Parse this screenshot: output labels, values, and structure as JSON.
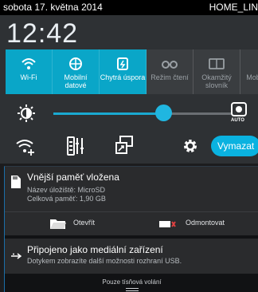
{
  "status_bar": {
    "date": "sobota 17. května 2014",
    "network": "HOME_LIN"
  },
  "clock": {
    "time": "12:42"
  },
  "quick_settings": [
    {
      "label": "Wi-Fi",
      "state": "on",
      "icon": "wifi-icon"
    },
    {
      "label": "Mobilní datové",
      "state": "on",
      "icon": "mobile-data-icon"
    },
    {
      "label": "Chytrá úspora",
      "state": "on",
      "icon": "smart-saving-icon"
    },
    {
      "label": "Režim čtení",
      "state": "off",
      "icon": "reading-mode-icon"
    },
    {
      "label": "Okamžitý slovník",
      "state": "off",
      "icon": "instant-dictionary-icon"
    },
    {
      "label": "Mob aktivn",
      "state": "off",
      "icon": "mobile-hotspot-icon"
    }
  ],
  "brightness": {
    "level": 0.6,
    "auto_label": "AUTO"
  },
  "clear_button": {
    "label": "Vymazat"
  },
  "colors": {
    "accent": "#0aa6c8",
    "tile_off": "#3a3d40",
    "background": "#2e3134"
  },
  "notifications": {
    "sd_card": {
      "title": "Vnější paměť vložena",
      "storage_name": "Název úložiště: MicroSD",
      "total_memory": "Celková paměť: 1,90 GB",
      "open_label": "Otevřít",
      "unmount_label": "Odmontovat"
    },
    "usb": {
      "title": "Připojeno jako mediální zařízení",
      "text": "Dotykem zobrazíte další možnosti rozhraní USB."
    }
  },
  "emergency": {
    "label": "Pouze tísňová volání"
  }
}
